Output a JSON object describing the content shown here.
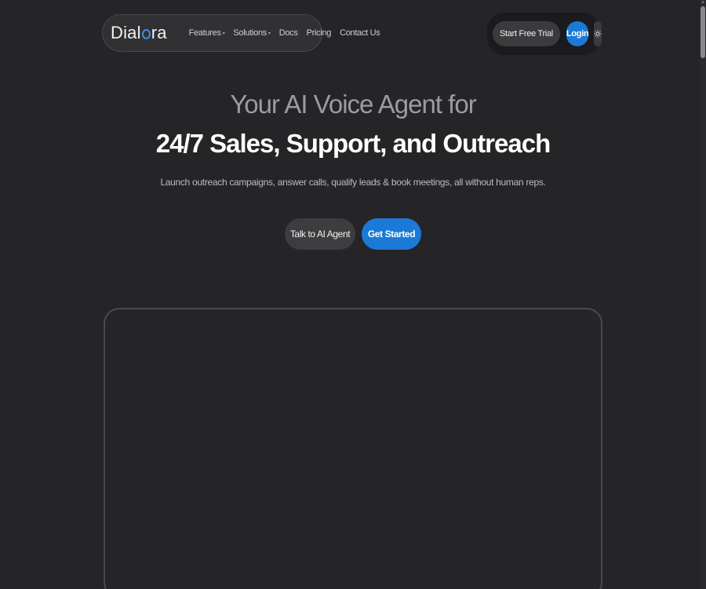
{
  "brand": {
    "logo_prefix": "Dial",
    "logo_suffix": "ra",
    "logo_icon": "o-ring-icon",
    "accent_color": "#1b7ad8"
  },
  "nav": {
    "links": [
      {
        "label": "Features",
        "dropdown": true
      },
      {
        "label": "Solutions",
        "dropdown": true
      },
      {
        "label": "Docs",
        "dropdown": false
      },
      {
        "label": "Pricing",
        "dropdown": false
      },
      {
        "label": "Contact Us",
        "dropdown": false
      }
    ],
    "trial_label": "Start Free Trial",
    "login_label": "Login",
    "theme_icon": "sun-icon"
  },
  "hero": {
    "line1": "Your AI Voice Agent for",
    "line2": "24/7 Sales, Support, and Outreach",
    "subtitle": "Launch outreach campaigns, answer calls, qualify leads & book meetings, all without human reps.",
    "talk_label": "Talk to AI Agent",
    "start_label": "Get Started"
  }
}
